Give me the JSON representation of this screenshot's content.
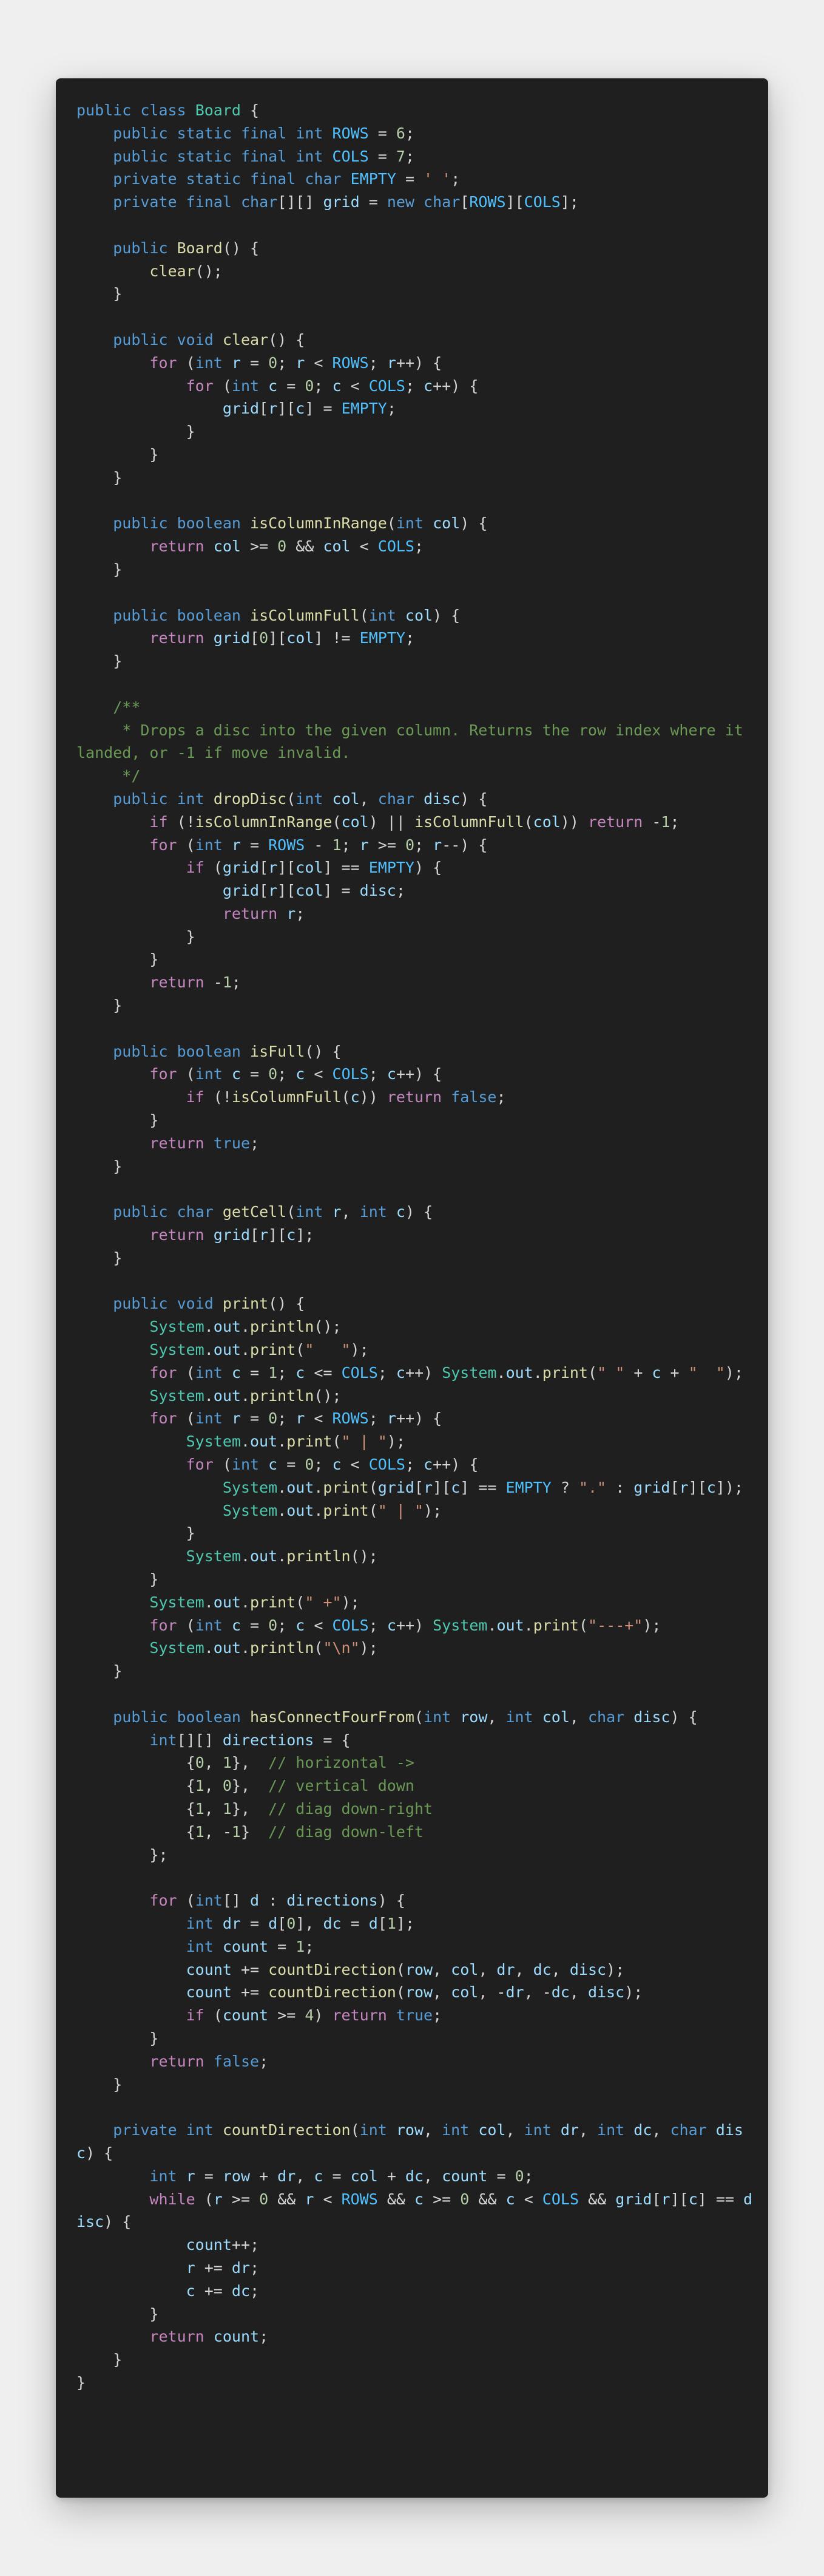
{
  "editor": {
    "language": "java",
    "colors": {
      "background": "#1f1f1f",
      "page": "#efefef",
      "plain": "#d4d4d4",
      "keyword": "#569cd6",
      "control": "#c586c0",
      "type": "#4ec9b0",
      "function": "#dcdcaa",
      "variable": "#9cdcfe",
      "constant": "#4fc1ff",
      "string": "#ce9178",
      "number": "#b5cea8",
      "comment": "#6a9955"
    }
  },
  "code_lines": [
    "public class Board {",
    "    public static final int ROWS = 6;",
    "    public static final int COLS = 7;",
    "    private static final char EMPTY = ' ';",
    "    private final char[][] grid = new char[ROWS][COLS];",
    "",
    "    public Board() {",
    "        clear();",
    "    }",
    "",
    "    public void clear() {",
    "        for (int r = 0; r < ROWS; r++) {",
    "            for (int c = 0; c < COLS; c++) {",
    "                grid[r][c] = EMPTY;",
    "            }",
    "        }",
    "    }",
    "",
    "    public boolean isColumnInRange(int col) {",
    "        return col >= 0 && col < COLS;",
    "    }",
    "",
    "    public boolean isColumnFull(int col) {",
    "        return grid[0][col] != EMPTY;",
    "    }",
    "",
    "    /**",
    "     * Drops a disc into the given column. Returns the row index where it landed, or -1 if move invalid.",
    "     */",
    "    public int dropDisc(int col, char disc) {",
    "        if (!isColumnInRange(col) || isColumnFull(col)) return -1;",
    "        for (int r = ROWS - 1; r >= 0; r--) {",
    "            if (grid[r][col] == EMPTY) {",
    "                grid[r][col] = disc;",
    "                return r;",
    "            }",
    "        }",
    "        return -1;",
    "    }",
    "",
    "    public boolean isFull() {",
    "        for (int c = 0; c < COLS; c++) {",
    "            if (!isColumnFull(c)) return false;",
    "        }",
    "        return true;",
    "    }",
    "",
    "    public char getCell(int r, int c) {",
    "        return grid[r][c];",
    "    }",
    "",
    "    public void print() {",
    "        System.out.println();",
    "        System.out.print(\"   \");",
    "        for (int c = 1; c <= COLS; c++) System.out.print(\" \" + c + \"  \");",
    "        System.out.println();",
    "        for (int r = 0; r < ROWS; r++) {",
    "            System.out.print(\" | \");",
    "            for (int c = 0; c < COLS; c++) {",
    "                System.out.print(grid[r][c] == EMPTY ? \".\" : grid[r][c]);",
    "                System.out.print(\" | \");",
    "            }",
    "            System.out.println();",
    "        }",
    "        System.out.print(\" +\");",
    "        for (int c = 0; c < COLS; c++) System.out.print(\"---+\");",
    "        System.out.println(\"\\n\");",
    "    }",
    "",
    "    public boolean hasConnectFourFrom(int row, int col, char disc) {",
    "        int[][] directions = {",
    "            {0, 1},  // horizontal ->",
    "            {1, 0},  // vertical down",
    "            {1, 1},  // diag down-right",
    "            {1, -1}  // diag down-left",
    "        };",
    "",
    "        for (int[] d : directions) {",
    "            int dr = d[0], dc = d[1];",
    "            int count = 1;",
    "            count += countDirection(row, col, dr, dc, disc);",
    "            count += countDirection(row, col, -dr, -dc, disc);",
    "            if (count >= 4) return true;",
    "        }",
    "        return false;",
    "    }",
    "",
    "    private int countDirection(int row, int col, int dr, int dc, char disc) {",
    "        int r = row + dr, c = col + dc, count = 0;",
    "        while (r >= 0 && r < ROWS && c >= 0 && c < COLS && grid[r][c] == disc) {",
    "            count++;",
    "            r += dr;",
    "            c += dc;",
    "        }",
    "        return count;",
    "    }",
    "}"
  ]
}
